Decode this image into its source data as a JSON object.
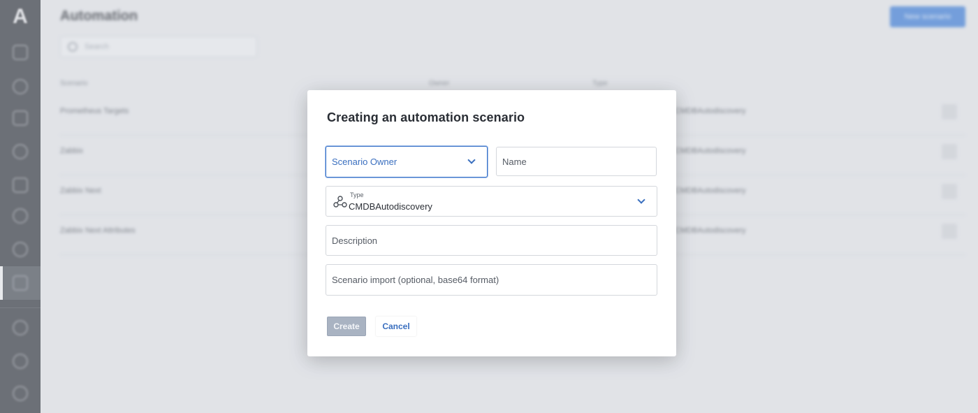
{
  "sidebar": {
    "logo_letter": "A",
    "icons": [
      "dashboard-icon",
      "circle-icon",
      "calendar-icon",
      "bug-icon",
      "flow-icon",
      "database-icon",
      "sync-icon",
      "automation-icon",
      "heart-icon",
      "help-icon",
      "settings-icon"
    ]
  },
  "page": {
    "title": "Automation",
    "new_button": "New scenario",
    "search_placeholder": "Search",
    "columns": [
      "Scenario",
      "Owner",
      "Type"
    ],
    "rows": [
      {
        "name": "Prometheus Targets",
        "type": "CMDBAutodiscovery"
      },
      {
        "name": "Zabbix",
        "type": "CMDBAutodiscovery"
      },
      {
        "name": "Zabbix Next",
        "type": "CMDBAutodiscovery"
      },
      {
        "name": "Zabbix Next Attributes",
        "type": "CMDBAutodiscovery"
      }
    ]
  },
  "modal": {
    "title": "Creating an automation scenario",
    "owner_placeholder": "Scenario Owner",
    "name_placeholder": "Name",
    "type_label": "Type",
    "type_value": "CMDBAutodiscovery",
    "description_placeholder": "Description",
    "import_placeholder": "Scenario import (optional, base64 format)",
    "create_label": "Create",
    "cancel_label": "Cancel"
  },
  "colors": {
    "accent": "#3a6fbf",
    "sidebar_bg": "#34383f",
    "create_disabled": "#a9b3c2"
  }
}
